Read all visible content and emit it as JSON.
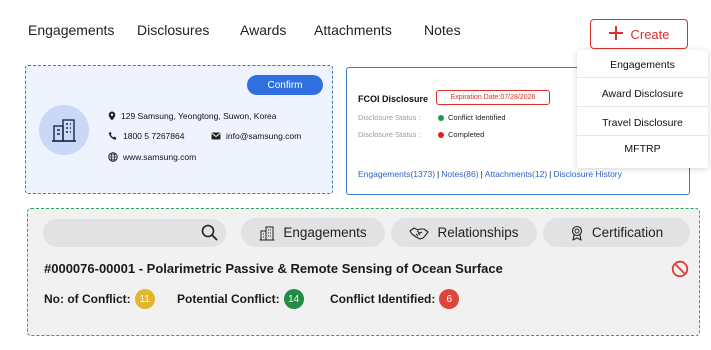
{
  "tabs": [
    "Engagements",
    "Disclosures",
    "Awards",
    "Attachments",
    "Notes"
  ],
  "create": {
    "label": "Create"
  },
  "create_menu": [
    "Engagements",
    "Award Disclosure",
    "Travel Disclosure",
    "MFTRP"
  ],
  "contact": {
    "confirm_label": "Confirm",
    "address": "129 Samsung, Yeongtong, Suwon, Korea",
    "phone": "1800 5 7267864",
    "email": "info@samsung.com",
    "website": "www.samsung.com"
  },
  "fcoi": {
    "title": "FCOI Disclosure",
    "expiration": "Expiration Date:07/28/2026",
    "statuses": [
      {
        "label": "Disclosure Status :",
        "value": "Conflict Identified",
        "color": "#1f9a44"
      },
      {
        "label": "Disclosure Status :",
        "value": "Completed",
        "color": "#e02020"
      }
    ],
    "links": [
      "Engagements(1373)",
      "Notes(86)",
      "Attachments(12)",
      "Disclosure History"
    ]
  },
  "engagement": {
    "tabs": [
      "Engagements",
      "Relationships",
      "Certification"
    ],
    "title": "#000076-00001 - Polarimetric Passive & Remote Sensing of Ocean Surface",
    "stats": [
      {
        "label": "No: of Conflict:",
        "value": "11",
        "color": "#e3b52b"
      },
      {
        "label": "Potential Conflict:",
        "value": "14",
        "color": "#228b44"
      },
      {
        "label": "Conflict Identified:",
        "value": "6",
        "color": "#e0453c"
      }
    ]
  },
  "colors": {
    "accent": "#2f6fe0",
    "danger": "#d9302c",
    "panel_border": "#35a162"
  },
  "icons": [
    "plus-icon",
    "building-icon",
    "location-pin-icon",
    "phone-icon",
    "mail-icon",
    "globe-icon",
    "search-icon",
    "handshake-icon",
    "award-icon",
    "ban-icon"
  ]
}
